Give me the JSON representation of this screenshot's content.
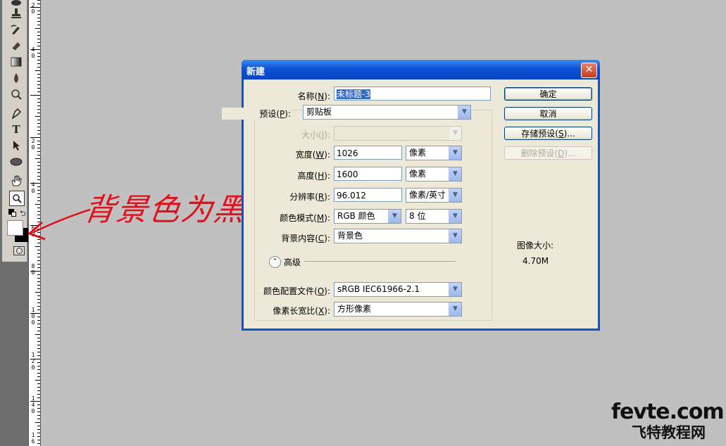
{
  "toolbox": {
    "tools": [
      "clone-stamp-icon",
      "history-brush-icon",
      "eraser-icon",
      "gradient-icon",
      "blur-icon",
      "dodge-icon",
      "pen-icon",
      "type-icon",
      "path-select-icon",
      "ellipse-icon",
      "hand-icon",
      "zoom-icon"
    ],
    "type_glyph": "T",
    "foreground_color": "#ffffff",
    "background_color": "#000000"
  },
  "ruler": {
    "labels": [
      {
        "digits": [
          "2",
          "0"
        ]
      },
      {
        "digits": [
          "4",
          "0"
        ]
      },
      {
        "digits": [
          "2",
          "0"
        ]
      },
      {
        "digits": [
          "4",
          "0"
        ]
      },
      {
        "digits": [
          "6",
          "0"
        ]
      },
      {
        "digits": [
          "8",
          "0"
        ]
      },
      {
        "digits": [
          "1",
          "0",
          "0"
        ]
      },
      {
        "digits": [
          "1",
          "2",
          "0"
        ]
      },
      {
        "digits": [
          "1",
          "4",
          "0"
        ]
      },
      {
        "digits": [
          "1",
          "6"
        ]
      }
    ]
  },
  "annotation": {
    "text": "背景色为黑色.",
    "color": "#e0101c"
  },
  "dialog": {
    "title": "新建",
    "close_glyph": "✕",
    "name": {
      "label": "名称(",
      "key": "N",
      "suffix": "):",
      "value": "未标题-3"
    },
    "preset": {
      "label": "预设(",
      "key": "P",
      "suffix": "):",
      "value": "剪贴板"
    },
    "size": {
      "label": "大小(",
      "key": "I",
      "suffix": "):",
      "value": ""
    },
    "width": {
      "label": "宽度(",
      "key": "W",
      "suffix": "):",
      "value": "1026",
      "unit": "像素"
    },
    "height": {
      "label": "高度(",
      "key": "H",
      "suffix": "):",
      "value": "1600",
      "unit": "像素"
    },
    "resolution": {
      "label": "分辨率(",
      "key": "R",
      "suffix": "):",
      "value": "96.012",
      "unit": "像素/英寸"
    },
    "color_mode": {
      "label": "颜色模式(",
      "key": "M",
      "suffix": "):",
      "value": "RGB 颜色",
      "depth": "8 位"
    },
    "background_contents": {
      "label": "背景内容(",
      "key": "C",
      "suffix": "):",
      "value": "背景色"
    },
    "advanced_label": "高级",
    "color_profile": {
      "label": "颜色配置文件(",
      "key": "O",
      "suffix": "):",
      "value": "sRGB IEC61966-2.1"
    },
    "pixel_aspect": {
      "label": "像素长宽比(",
      "key": "X",
      "suffix": "):",
      "value": "方形像素"
    },
    "buttons": {
      "ok": "确定",
      "cancel": "取消",
      "save_preset": {
        "text": "存储预设(",
        "key": "S",
        "suffix": ")..."
      },
      "delete_preset": {
        "text": "删除预设(",
        "key": "D",
        "suffix": ")..."
      }
    },
    "image_size_label": "图像大小:",
    "image_size_value": "4.70M"
  },
  "watermark": {
    "line1": "fevte.com",
    "line2": "飞特教程网"
  }
}
